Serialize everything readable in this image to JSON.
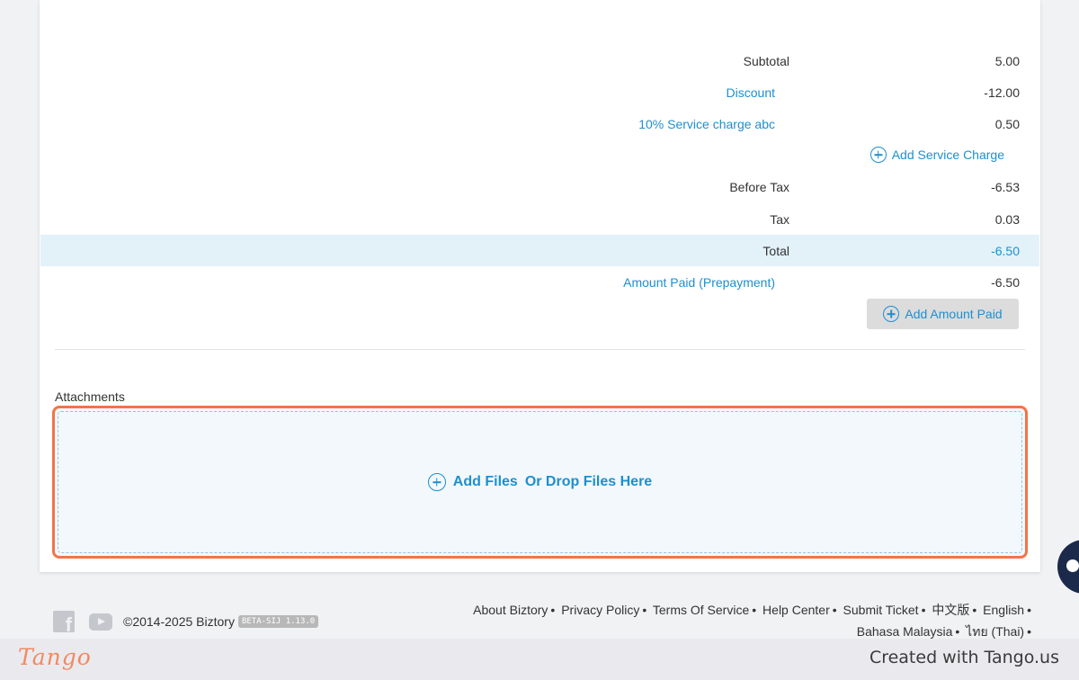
{
  "summary": {
    "subtotal": {
      "label": "Subtotal",
      "value": "5.00"
    },
    "discount": {
      "label": "Discount",
      "value": "-12.00"
    },
    "service_charge": {
      "label": "10% Service charge abc",
      "value": "0.50"
    },
    "add_service_charge_label": "Add Service Charge",
    "before_tax": {
      "label": "Before Tax",
      "value": "-6.53"
    },
    "tax": {
      "label": "Tax",
      "value": "0.03"
    },
    "total": {
      "label": "Total",
      "value": "-6.50"
    },
    "amount_paid": {
      "label": "Amount Paid (Prepayment)",
      "value": "-6.50"
    },
    "add_amount_paid_label": "Add Amount Paid"
  },
  "attachments": {
    "label": "Attachments",
    "add_files_label": "Add Files",
    "drop_label": "Or Drop Files Here"
  },
  "footer": {
    "copyright": "©2014-2025 Biztory",
    "version_badge": "BETA-SIJ 1.13.0",
    "links": [
      "About Biztory",
      "Privacy Policy",
      "Terms Of Service",
      "Help Center",
      "Submit Ticket",
      "中文版",
      "English",
      "Bahasa Malaysia",
      "ไทย (Thai)"
    ],
    "social_icons": [
      "facebook-icon",
      "youtube-icon"
    ]
  },
  "tango": {
    "logo": "Tango",
    "credit": "Created with Tango.us"
  },
  "colors": {
    "link": "#1d8fd0",
    "highlight_border": "#f27449",
    "total_row_bg": "#e3f1f9",
    "dropzone_bg": "#f2f8fc"
  }
}
